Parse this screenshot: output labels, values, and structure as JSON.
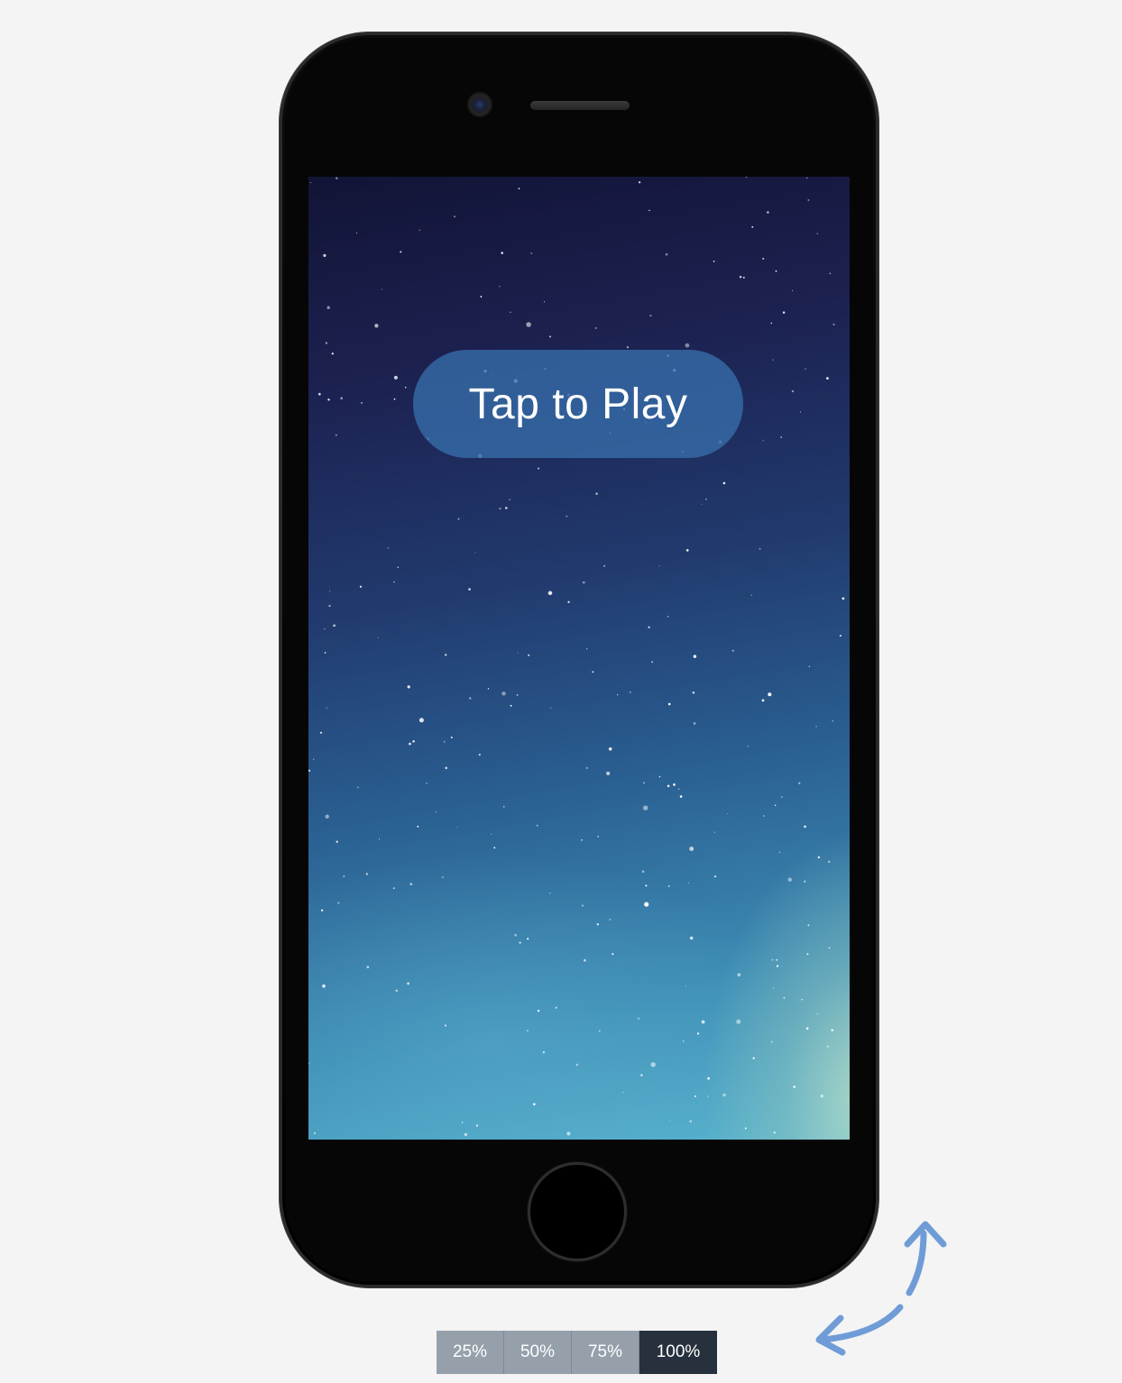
{
  "game": {
    "play_button_label": "Tap to Play"
  },
  "device": {
    "icons": {
      "camera": "camera-icon",
      "speaker": "speaker-icon",
      "home": "home-button",
      "rotate": "rotate-icon"
    }
  },
  "zoom": {
    "options": [
      {
        "label": "25%"
      },
      {
        "label": "50%"
      },
      {
        "label": "75%"
      },
      {
        "label": "100%"
      }
    ],
    "selected": "100%"
  },
  "colors": {
    "page_background": "#f4f4f4",
    "play_button": "#376eaa",
    "zoom_inactive": "#95a0ab",
    "zoom_active": "#27313d",
    "rotate_arrow": "#6f9cd6"
  }
}
